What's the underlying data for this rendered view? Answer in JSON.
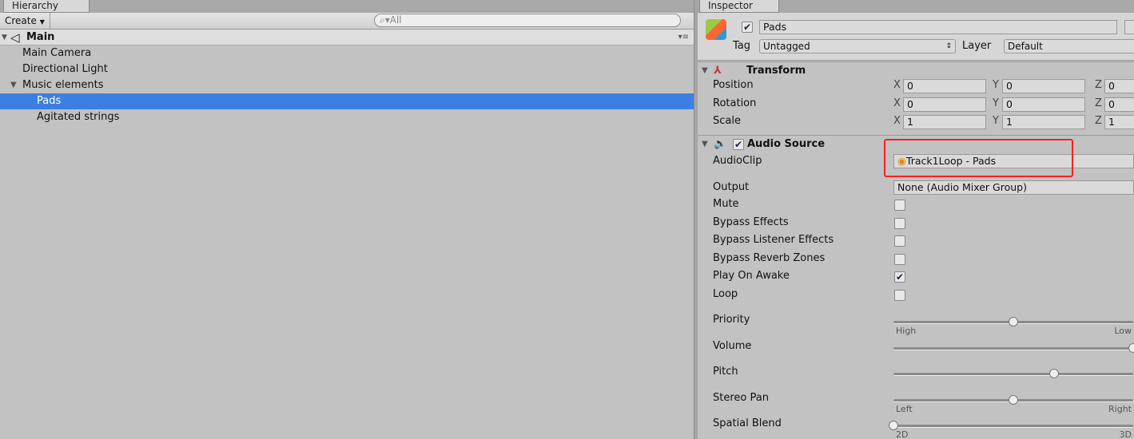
{
  "hierarchy": {
    "tab": "Hierarchy",
    "create": "Create",
    "search_placeholder": "All",
    "scene": "Main",
    "items": [
      {
        "label": "Main Camera"
      },
      {
        "label": "Directional Light"
      },
      {
        "label": "Music elements"
      },
      {
        "label": "Pads",
        "selected": true
      },
      {
        "label": "Agitated strings"
      }
    ]
  },
  "inspector": {
    "tab": "Inspector",
    "object_name": "Pads",
    "active": true,
    "tag_label": "Tag",
    "tag": "Untagged",
    "layer_label": "Layer",
    "layer": "Default",
    "transform": {
      "title": "Transform",
      "rows": [
        {
          "label": "Position",
          "x": "0",
          "y": "0",
          "z": "0"
        },
        {
          "label": "Rotation",
          "x": "0",
          "y": "0",
          "z": "0"
        },
        {
          "label": "Scale",
          "x": "1",
          "y": "1",
          "z": "1"
        }
      ],
      "axis_x": "X",
      "axis_y": "Y",
      "axis_z": "Z"
    },
    "audio_source": {
      "title": "Audio Source",
      "enabled": true,
      "audioclip_label": "AudioClip",
      "audioclip": "Track1Loop - Pads",
      "output_label": "Output",
      "output": "None (Audio Mixer Group)",
      "toggles": [
        {
          "label": "Mute",
          "checked": false
        },
        {
          "label": "Bypass Effects",
          "checked": false
        },
        {
          "label": "Bypass Listener Effects",
          "checked": false
        },
        {
          "label": "Bypass Reverb Zones",
          "checked": false
        },
        {
          "label": "Play On Awake",
          "checked": true
        },
        {
          "label": "Loop",
          "checked": false
        }
      ],
      "sliders": [
        {
          "label": "Priority",
          "value": 0.5,
          "min_label": "High",
          "max_label": "Low"
        },
        {
          "label": "Volume",
          "value": 1.0
        },
        {
          "label": "Pitch",
          "value": 0.67
        },
        {
          "label": "Stereo Pan",
          "value": 0.5,
          "min_label": "Left",
          "max_label": "Right"
        },
        {
          "label": "Spatial Blend",
          "value": 0.0,
          "min_label": "2D",
          "max_label": "3D"
        }
      ]
    },
    "highlight_color": "#ff2020"
  },
  "colors": {
    "selection": "#3d7fe0",
    "panel": "#c2c2c2"
  }
}
